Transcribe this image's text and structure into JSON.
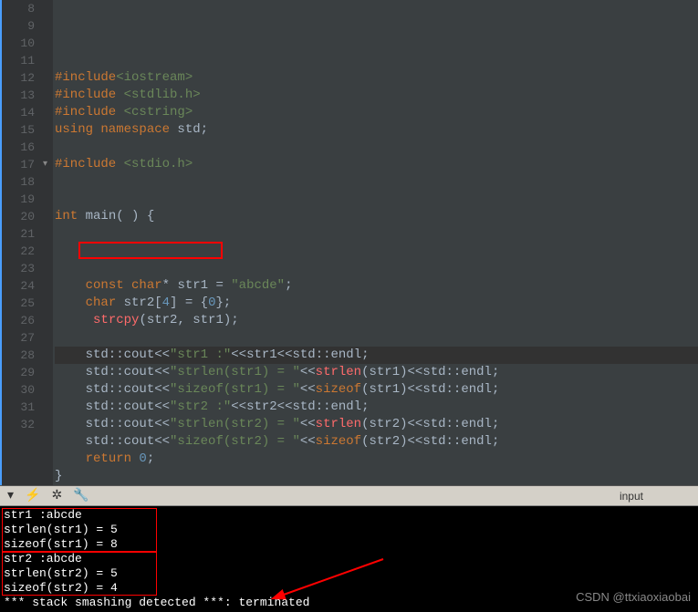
{
  "editor": {
    "first_line": 8,
    "lines": [
      {
        "n": 8,
        "tokens": []
      },
      {
        "n": 9,
        "tokens": [
          [
            "pp",
            "#include"
          ],
          [
            "inc",
            "<iostream>"
          ]
        ]
      },
      {
        "n": 10,
        "tokens": [
          [
            "pp",
            "#include "
          ],
          [
            "inc",
            "<stdlib.h>"
          ]
        ]
      },
      {
        "n": 11,
        "tokens": [
          [
            "pp",
            "#include "
          ],
          [
            "inc",
            "<cstring>"
          ]
        ]
      },
      {
        "n": 12,
        "tokens": [
          [
            "kw",
            "using namespace "
          ],
          [
            "type",
            "std"
          ],
          [
            "op",
            ";"
          ]
        ]
      },
      {
        "n": 13,
        "tokens": []
      },
      {
        "n": 14,
        "tokens": [
          [
            "pp",
            "#include "
          ],
          [
            "inc",
            "<stdio.h>"
          ]
        ]
      },
      {
        "n": 15,
        "tokens": []
      },
      {
        "n": 16,
        "tokens": []
      },
      {
        "n": 17,
        "tokens": [
          [
            "kw",
            "int "
          ],
          [
            "type",
            "main"
          ],
          [
            "op",
            "( ) {"
          ]
        ],
        "fold": true
      },
      {
        "n": 18,
        "tokens": []
      },
      {
        "n": 19,
        "tokens": []
      },
      {
        "n": 20,
        "tokens": []
      },
      {
        "n": 21,
        "tokens": [
          [
            "",
            "    "
          ],
          [
            "kw",
            "const char"
          ],
          [
            "op",
            "* "
          ],
          [
            "type",
            "str1"
          ],
          [
            "op",
            " = "
          ],
          [
            "str",
            "\"abcde\""
          ],
          [
            "op",
            ";"
          ]
        ]
      },
      {
        "n": 22,
        "tokens": [
          [
            "",
            "    "
          ],
          [
            "kw",
            "char "
          ],
          [
            "type",
            "str2"
          ],
          [
            "op",
            "["
          ],
          [
            "num",
            "4"
          ],
          [
            "op",
            "] = {"
          ],
          [
            "num",
            "0"
          ],
          [
            "op",
            "};"
          ]
        ],
        "boxed": true
      },
      {
        "n": 23,
        "tokens": [
          [
            "",
            "     "
          ],
          [
            "func",
            "strcpy"
          ],
          [
            "op",
            "(str2, str1);"
          ]
        ]
      },
      {
        "n": 24,
        "tokens": []
      },
      {
        "n": 25,
        "tokens": [
          [
            "",
            "    std::cout"
          ],
          [
            "op",
            "<<"
          ],
          [
            "str",
            "\"str1 :\""
          ],
          [
            "op",
            "<<"
          ],
          [
            "type",
            "str1"
          ],
          [
            "op",
            "<<"
          ],
          [
            "type",
            "std::endl"
          ],
          [
            "op",
            ";"
          ]
        ],
        "hl": true
      },
      {
        "n": 26,
        "tokens": [
          [
            "",
            "    std::cout"
          ],
          [
            "op",
            "<<"
          ],
          [
            "str",
            "\"strlen(str1) = \""
          ],
          [
            "op",
            "<<"
          ],
          [
            "func",
            "strlen"
          ],
          [
            "op",
            "(str1)"
          ],
          [
            "op",
            "<<"
          ],
          [
            "type",
            "std::endl"
          ],
          [
            "op",
            ";"
          ]
        ]
      },
      {
        "n": 27,
        "tokens": [
          [
            "",
            "    std::cout"
          ],
          [
            "op",
            "<<"
          ],
          [
            "str",
            "\"sizeof(str1) = \""
          ],
          [
            "op",
            "<<"
          ],
          [
            "kw",
            "sizeof"
          ],
          [
            "op",
            "(str1)"
          ],
          [
            "op",
            "<<"
          ],
          [
            "type",
            "std::endl"
          ],
          [
            "op",
            ";"
          ]
        ]
      },
      {
        "n": 28,
        "tokens": [
          [
            "",
            "    std::cout"
          ],
          [
            "op",
            "<<"
          ],
          [
            "str",
            "\"str2 :\""
          ],
          [
            "op",
            "<<"
          ],
          [
            "type",
            "str2"
          ],
          [
            "op",
            "<<"
          ],
          [
            "type",
            "std::endl"
          ],
          [
            "op",
            ";"
          ]
        ]
      },
      {
        "n": 29,
        "tokens": [
          [
            "",
            "    std::cout"
          ],
          [
            "op",
            "<<"
          ],
          [
            "str",
            "\"strlen(str2) = \""
          ],
          [
            "op",
            "<<"
          ],
          [
            "func",
            "strlen"
          ],
          [
            "op",
            "(str2)"
          ],
          [
            "op",
            "<<"
          ],
          [
            "type",
            "std::endl"
          ],
          [
            "op",
            ";"
          ]
        ]
      },
      {
        "n": 30,
        "tokens": [
          [
            "",
            "    std::cout"
          ],
          [
            "op",
            "<<"
          ],
          [
            "str",
            "\"sizeof(str2) = \""
          ],
          [
            "op",
            "<<"
          ],
          [
            "kw",
            "sizeof"
          ],
          [
            "op",
            "(str2)"
          ],
          [
            "op",
            "<<"
          ],
          [
            "type",
            "std::endl"
          ],
          [
            "op",
            ";"
          ]
        ]
      },
      {
        "n": 31,
        "tokens": [
          [
            "",
            "    "
          ],
          [
            "kw",
            "return "
          ],
          [
            "num",
            "0"
          ],
          [
            "op",
            ";"
          ]
        ]
      },
      {
        "n": 32,
        "tokens": [
          [
            "op",
            "}"
          ]
        ]
      }
    ]
  },
  "toolbar": {
    "tab_label": "input"
  },
  "console": {
    "lines": [
      "str1 :abcde",
      "strlen(str1) = 5",
      "sizeof(str1) = 8",
      "str2 :abcde",
      "strlen(str2) = 5",
      "sizeof(str2) = 4",
      "*** stack smashing detected ***: terminated"
    ]
  },
  "watermark": "CSDN @ttxiaoxiaobai"
}
